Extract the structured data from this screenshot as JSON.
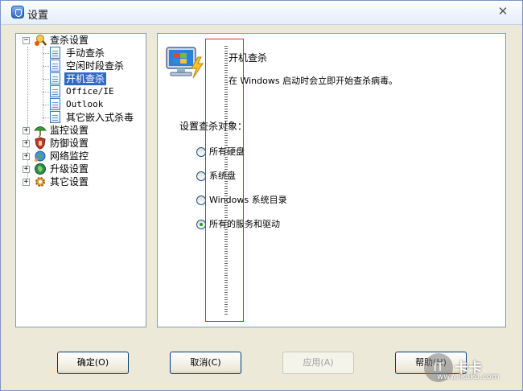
{
  "window": {
    "title": "设置"
  },
  "tree": {
    "root": "查杀设置",
    "children": [
      "手动查杀",
      "空闲时段查杀",
      "开机查杀",
      "Office/IE",
      "Outlook",
      "其它嵌入式杀毒"
    ],
    "selected": "开机查杀",
    "others": [
      "监控设置",
      "防御设置",
      "网络监控",
      "升级设置",
      "其它设置"
    ]
  },
  "content": {
    "heading": "开机查杀",
    "description": "在 Windows 启动时会立即开始查杀病毒。",
    "target_label": "设置查杀对象：",
    "options": [
      {
        "label": "所有硬盘",
        "checked": false
      },
      {
        "label": "系统盘",
        "checked": false
      },
      {
        "label": "Windows 系统目录",
        "checked": false
      },
      {
        "label": "所有的服务和驱动",
        "checked": true
      }
    ]
  },
  "buttons": {
    "ok": "确定(O)",
    "cancel": "取消(C)",
    "apply": "应用(A)",
    "help": "帮助(H)"
  },
  "watermark": {
    "circle": "IT",
    "brand": "卡卡",
    "url": "www.ikaka.com"
  },
  "colors": {
    "selection": "#316ac5",
    "annotation_box": "#c0392b"
  }
}
